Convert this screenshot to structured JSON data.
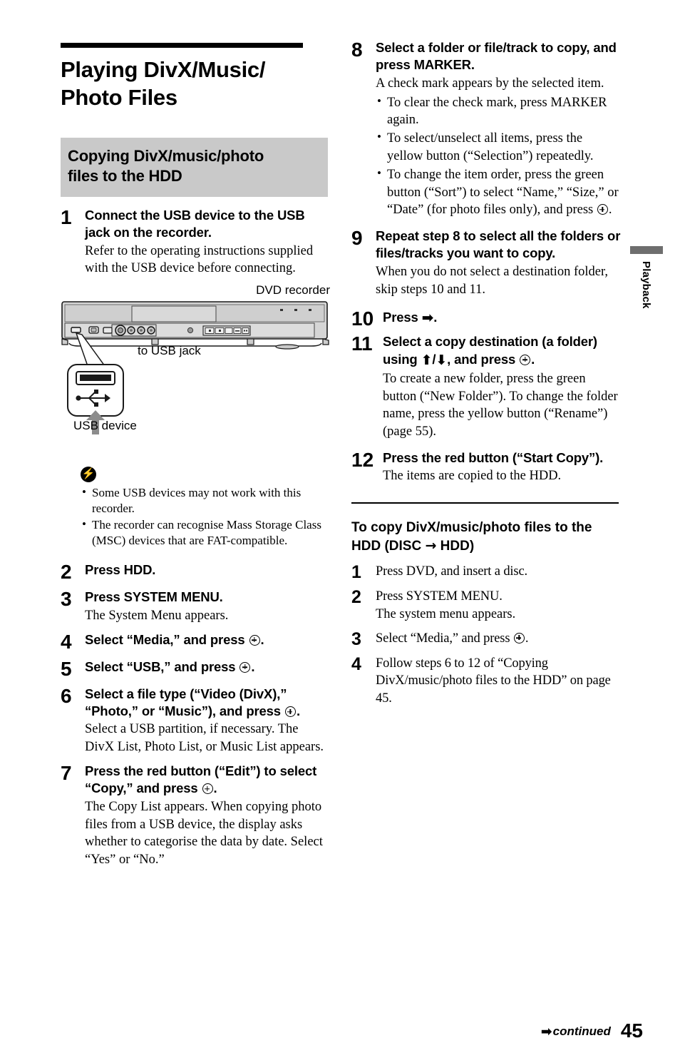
{
  "page": {
    "number": "45",
    "continued_label": "continued",
    "continued_arrow": "➡",
    "side_tab": "Playback"
  },
  "title": "Playing DivX/Music/\nPhoto Files",
  "section": {
    "heading": "Copying DivX/music/photo\nfiles to the HDD"
  },
  "icons": {
    "enter": "enter-button-icon",
    "arrow_right": "➡",
    "arrow_up": "⬆",
    "arrow_down": "⬇",
    "arrow_thin_right": "→",
    "note": "note-lightning-icon"
  },
  "steps_left": [
    {
      "num": "1",
      "head": "Connect the USB device to the USB jack on the recorder.",
      "desc": "Refer to the operating instructions supplied with the USB device before connecting."
    },
    {
      "num": "2",
      "head": "Press HDD.",
      "desc": ""
    },
    {
      "num": "3",
      "head": "Press SYSTEM MENU.",
      "desc": "The System Menu appears."
    },
    {
      "num": "4",
      "head_pre": "Select “Media,” and press ",
      "head_post": ".",
      "enter": true
    },
    {
      "num": "5",
      "head_pre": "Select “USB,” and press ",
      "head_post": ".",
      "enter": true
    },
    {
      "num": "6",
      "head_pre": "Select a file type (“Video (DivX),” “Photo,” or “Music”), and press ",
      "head_post": ".",
      "enter": true,
      "desc": "Select a USB partition, if necessary.\nThe DivX List, Photo List, or Music List appears."
    },
    {
      "num": "7",
      "head_pre": "Press the red button (“Edit”) to select “Copy,” and press ",
      "head_post": ".",
      "enter": true,
      "desc": "The Copy List appears.\nWhen copying photo files from a USB device, the display asks whether to categorise the data by date. Select “Yes” or “No.”"
    }
  ],
  "diagram": {
    "dvd_recorder_label": "DVD recorder",
    "usb_jack_label": "to USB jack",
    "usb_device_label": "USB device"
  },
  "notes": {
    "items": [
      "Some USB devices may not work with this recorder.",
      "The recorder can recognise Mass Storage Class (MSC) devices that are FAT-compatible."
    ]
  },
  "steps_right": [
    {
      "num": "8",
      "head": "Select a folder or file/track to copy, and press MARKER.",
      "desc": "A check mark appears by the selected item.",
      "bullets": [
        {
          "text": "To clear the check mark, press MARKER again."
        },
        {
          "text": "To select/unselect all items, press the yellow button (“Selection”) repeatedly."
        },
        {
          "pre": "To change the item order, press the green button (“Sort”) to select “Name,” “Size,” or “Date” (for photo files only), and press ",
          "post": ".",
          "enter": true
        }
      ]
    },
    {
      "num": "9",
      "head": "Repeat step 8 to select all the folders or files/tracks you want to copy.",
      "desc": "When you do not select a destination folder, skip steps 10 and 11."
    },
    {
      "num": "10",
      "head_pre": "Press ",
      "head_post": ".",
      "arrow": "right",
      "wide": true
    },
    {
      "num": "11",
      "head_pre": "Select a copy destination (a folder) using ",
      "head_mid": ", and press ",
      "head_post": ".",
      "updown": true,
      "enter": true,
      "wide": true,
      "desc": "To create a new folder, press the green button (“New Folder”).\nTo change the folder name, press the yellow button (“Rename”) (page 55)."
    },
    {
      "num": "12",
      "head": "Press the red button (“Start Copy”).",
      "desc": "The items are copied to the HDD.",
      "wide": true
    }
  ],
  "subsection": {
    "heading_pre": "To copy DivX/music/photo files to the HDD (DISC ",
    "heading_post": " HDD)",
    "steps": [
      {
        "num": "1",
        "head": "Press DVD, and insert a disc.",
        "desc": ""
      },
      {
        "num": "2",
        "head": "Press SYSTEM MENU.",
        "desc": "The system menu appears."
      },
      {
        "num": "3",
        "head_pre": "Select “Media,” and press ",
        "head_post": ".",
        "enter": true
      },
      {
        "num": "4",
        "head": "Follow steps 6 to 12 of “Copying DivX/music/photo files to the HDD” on page 45.",
        "desc": ""
      }
    ]
  }
}
